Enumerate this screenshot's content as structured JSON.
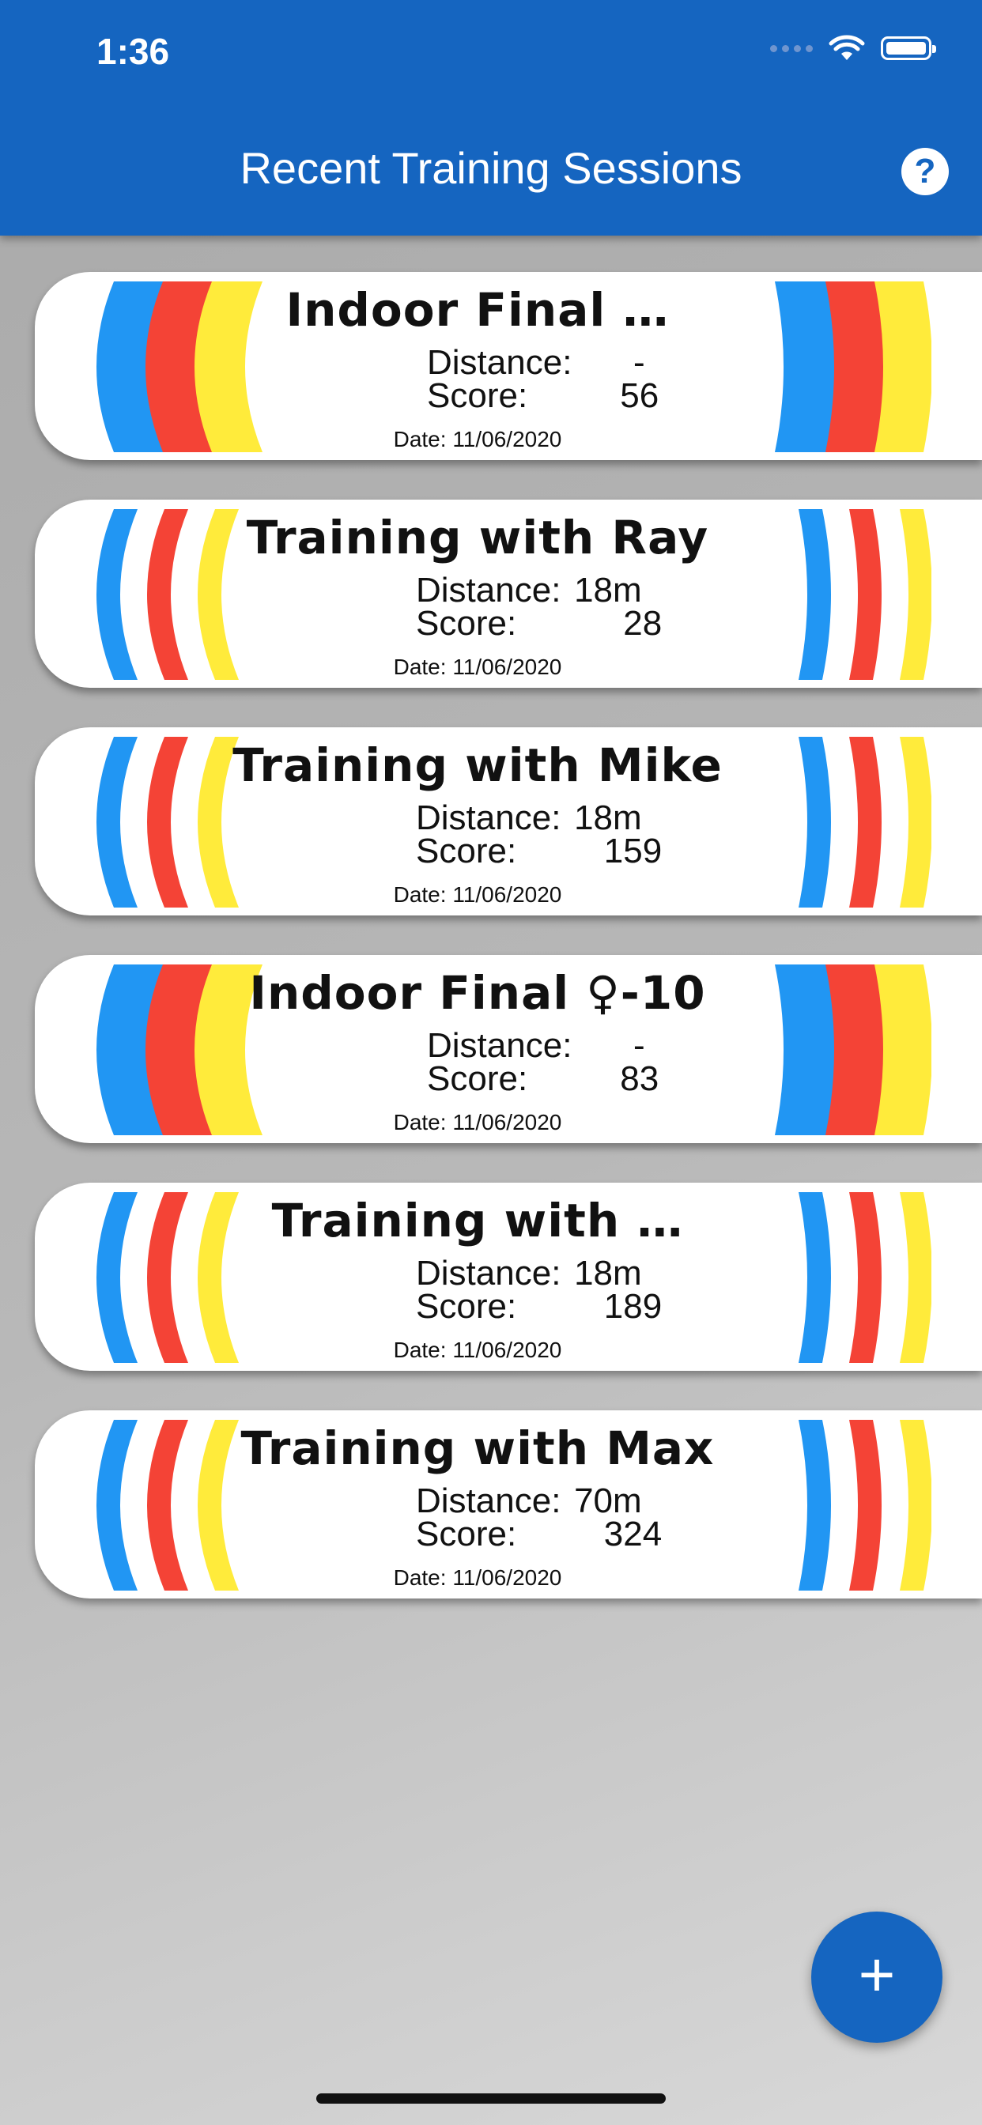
{
  "status_bar": {
    "time": "1:36"
  },
  "header": {
    "title": "Recent Training Sessions",
    "help_label": "?"
  },
  "colors": {
    "blue": "#2196f3",
    "red": "#f44336",
    "yellow": "#ffeb3b",
    "appbar": "#1565c0"
  },
  "sessions": [
    {
      "title": "Indoor Final …",
      "distance_label": "Distance:",
      "distance": "-",
      "score_label": "Score:",
      "score": "56",
      "date": "Date: 11/06/2020",
      "style": "solid"
    },
    {
      "title": "Training with Ray",
      "distance_label": "Distance:",
      "distance": "18m",
      "score_label": "Score:",
      "score": "28",
      "date": "Date: 11/06/2020",
      "style": "striped"
    },
    {
      "title": "Training with Mike",
      "distance_label": "Distance:",
      "distance": "18m",
      "score_label": "Score:",
      "score": "159",
      "date": "Date: 11/06/2020",
      "style": "striped"
    },
    {
      "title": "Indoor Final ♀-10",
      "distance_label": "Distance:",
      "distance": "-",
      "score_label": "Score:",
      "score": "83",
      "date": "Date: 11/06/2020",
      "style": "solid"
    },
    {
      "title": "Training with …",
      "distance_label": "Distance:",
      "distance": "18m",
      "score_label": "Score:",
      "score": "189",
      "date": "Date: 11/06/2020",
      "style": "striped"
    },
    {
      "title": "Training with Max",
      "distance_label": "Distance:",
      "distance": "70m",
      "score_label": "Score:",
      "score": "324",
      "date": "Date: 11/06/2020",
      "style": "striped"
    }
  ],
  "fab": {
    "label": "+",
    "icon": "plus-icon"
  }
}
